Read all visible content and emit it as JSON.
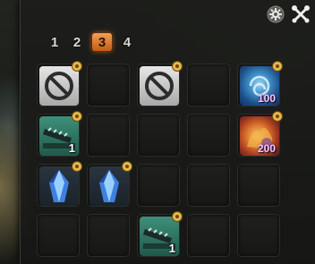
{
  "window": {
    "title_icons": [
      {
        "name": "settings-gear-icon"
      },
      {
        "name": "crossed-tools-icon"
      }
    ]
  },
  "tabs": [
    {
      "label": "1",
      "active": false
    },
    {
      "label": "2",
      "active": false
    },
    {
      "label": "3",
      "active": true
    },
    {
      "label": "4",
      "active": false
    }
  ],
  "colors": {
    "active_tab": "#d9742a",
    "gear_badge": "#e8b84a",
    "count_text": "#ffffff",
    "count_text_alt": "#f2c8ff"
  },
  "slots": [
    {
      "icon": "prohibited-icon",
      "count": ""
    },
    {
      "icon": "",
      "count": ""
    },
    {
      "icon": "prohibited-icon",
      "count": ""
    },
    {
      "icon": "",
      "count": ""
    },
    {
      "icon": "water-vortex-icon",
      "count": "100"
    },
    {
      "icon": "cannon-icon",
      "count": "1"
    },
    {
      "icon": "",
      "count": ""
    },
    {
      "icon": "",
      "count": ""
    },
    {
      "icon": "",
      "count": ""
    },
    {
      "icon": "fire-burst-icon",
      "count": "200"
    },
    {
      "icon": "crystal-shard-icon",
      "count": ""
    },
    {
      "icon": "crystal-shard-icon",
      "count": ""
    },
    {
      "icon": "",
      "count": ""
    },
    {
      "icon": "",
      "count": ""
    },
    {
      "icon": "",
      "count": ""
    },
    {
      "icon": "",
      "count": ""
    },
    {
      "icon": "",
      "count": ""
    },
    {
      "icon": "cannon-icon",
      "count": "1"
    },
    {
      "icon": "",
      "count": ""
    },
    {
      "icon": "",
      "count": ""
    }
  ]
}
